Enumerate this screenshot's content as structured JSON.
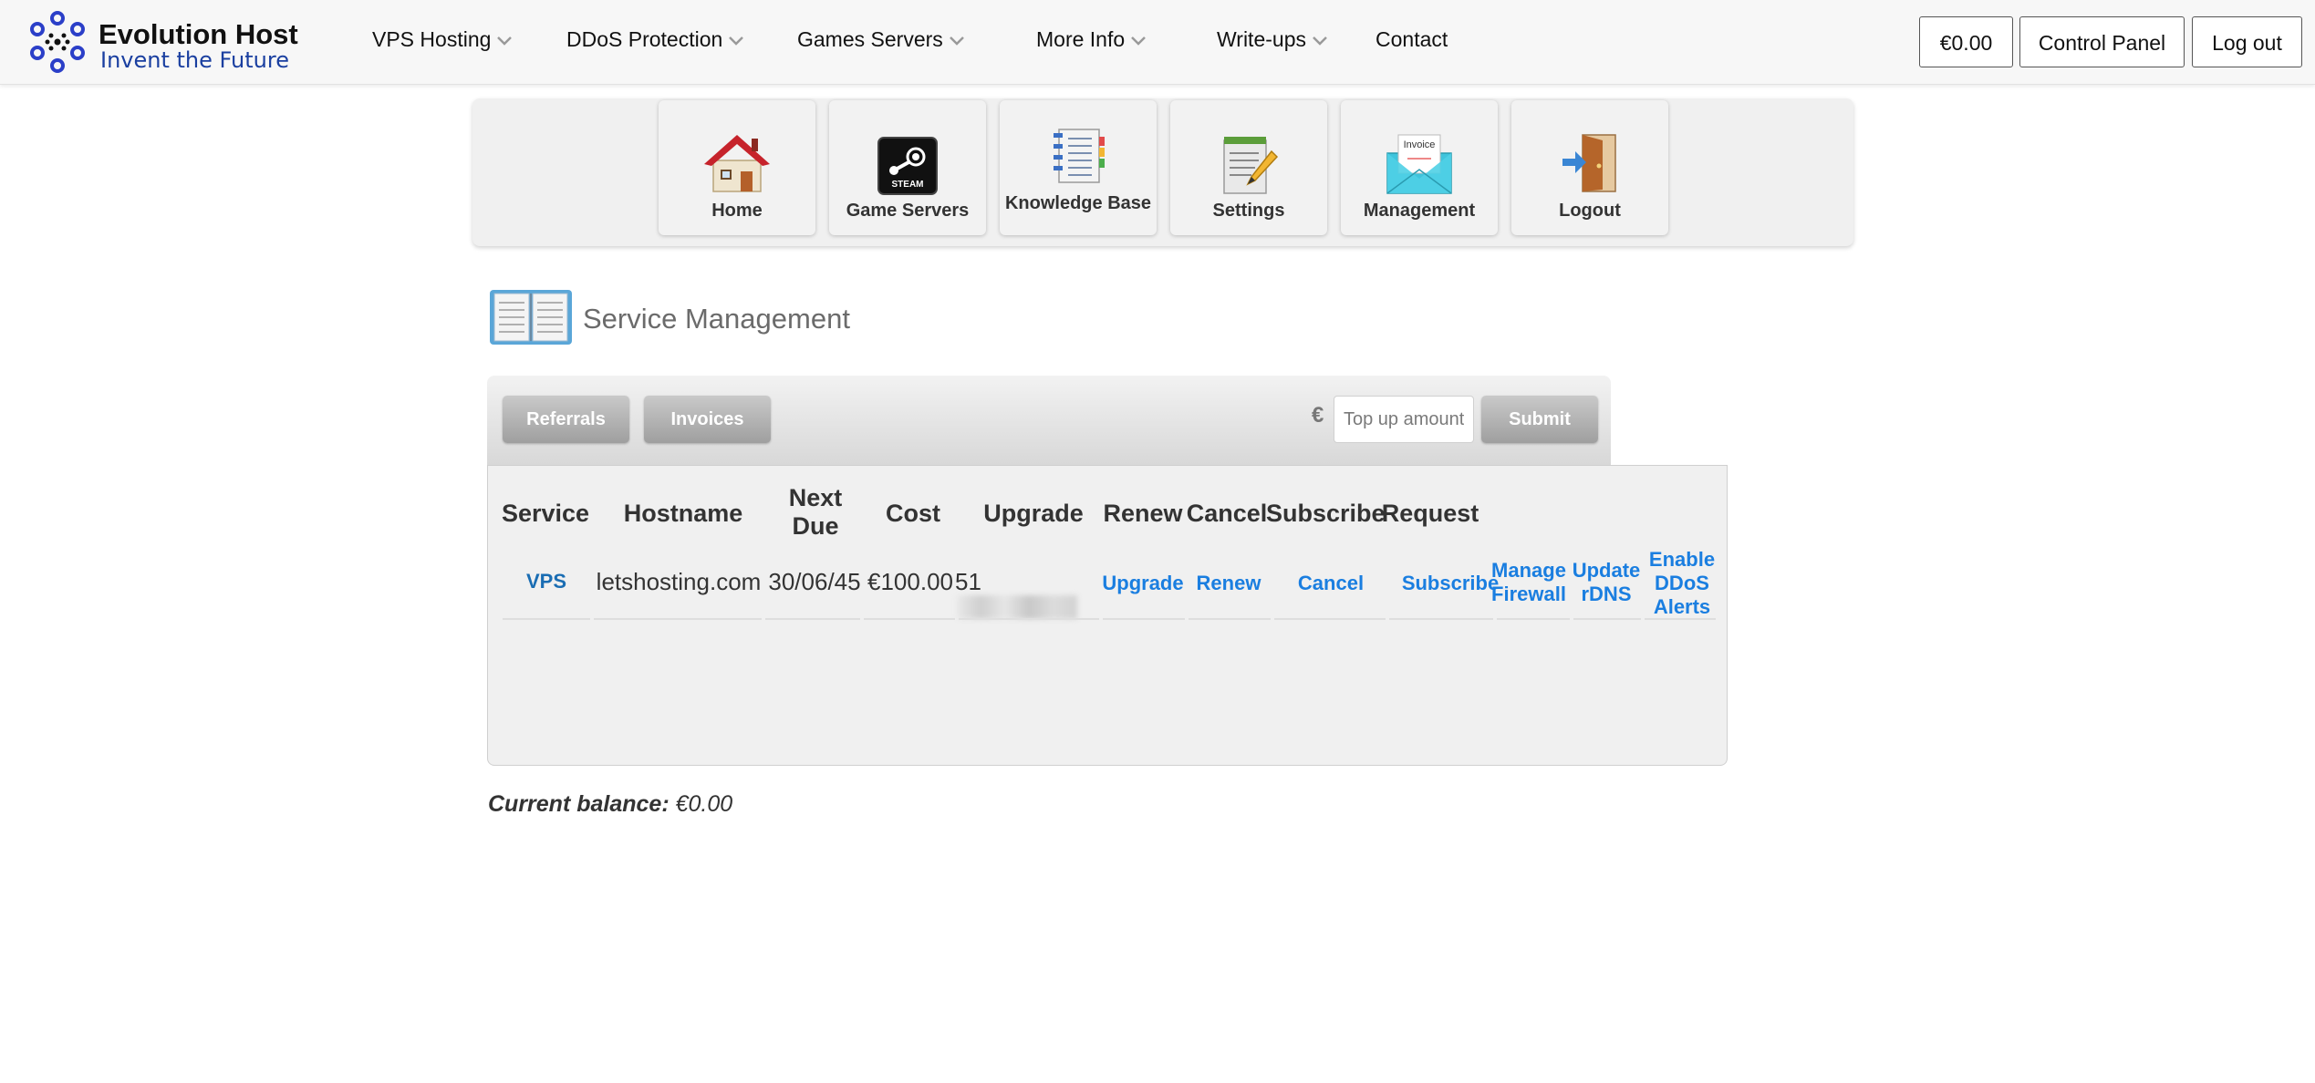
{
  "header": {
    "brand": "Evolution Host",
    "tagline": "Invent the Future",
    "nav": [
      {
        "label": "VPS Hosting",
        "has_dropdown": true
      },
      {
        "label": "DDoS Protection",
        "has_dropdown": true
      },
      {
        "label": "Games Servers",
        "has_dropdown": true
      },
      {
        "label": "More Info",
        "has_dropdown": true
      },
      {
        "label": "Write-ups",
        "has_dropdown": true
      },
      {
        "label": "Contact",
        "has_dropdown": false
      }
    ],
    "balance_button": "€0.00",
    "control_panel_button": "Control Panel",
    "logout_button": "Log out"
  },
  "icon_menu": [
    {
      "label": "Home",
      "icon": "house-icon"
    },
    {
      "label": "Game Servers",
      "icon": "steam-icon"
    },
    {
      "label": "Knowledge Base",
      "icon": "notebook-icon"
    },
    {
      "label": "Settings",
      "icon": "notepad-pencil-icon"
    },
    {
      "label": "Management",
      "icon": "invoice-envelope-icon"
    },
    {
      "label": "Logout",
      "icon": "door-exit-icon"
    }
  ],
  "page": {
    "title": "Service Management",
    "title_icon": "open-book-icon"
  },
  "toolbar": {
    "referrals_label": "Referrals",
    "invoices_label": "Invoices",
    "currency_symbol": "€",
    "topup_placeholder": "Top up amount",
    "submit_label": "Submit"
  },
  "services_table": {
    "headers": [
      "Service",
      "Hostname",
      "Next Due",
      "Cost",
      "Upgrade",
      "Renew",
      "Cancel",
      "Subscribe",
      "Request"
    ],
    "rows": [
      {
        "service": "VPS",
        "hostname": "letshosting.com",
        "next_due": "30/06/45",
        "cost": "€100.00",
        "ip_visible": "51",
        "upgrade": "Upgrade",
        "renew": "Renew",
        "cancel": "Cancel",
        "subscribe": "Subscribe",
        "request_manage_firewall": "Manage Firewall",
        "request_update_rdns": "Update rDNS",
        "request_enable_ddos_alerts": "Enable DDoS Alerts"
      }
    ]
  },
  "balance": {
    "label": "Current balance:",
    "value": "€0.00"
  },
  "colors": {
    "link": "#1a7ee0",
    "button_grey": "#a9a9a9",
    "tagline": "#1a3fa0",
    "logo_blue": "#2b3fc8"
  }
}
